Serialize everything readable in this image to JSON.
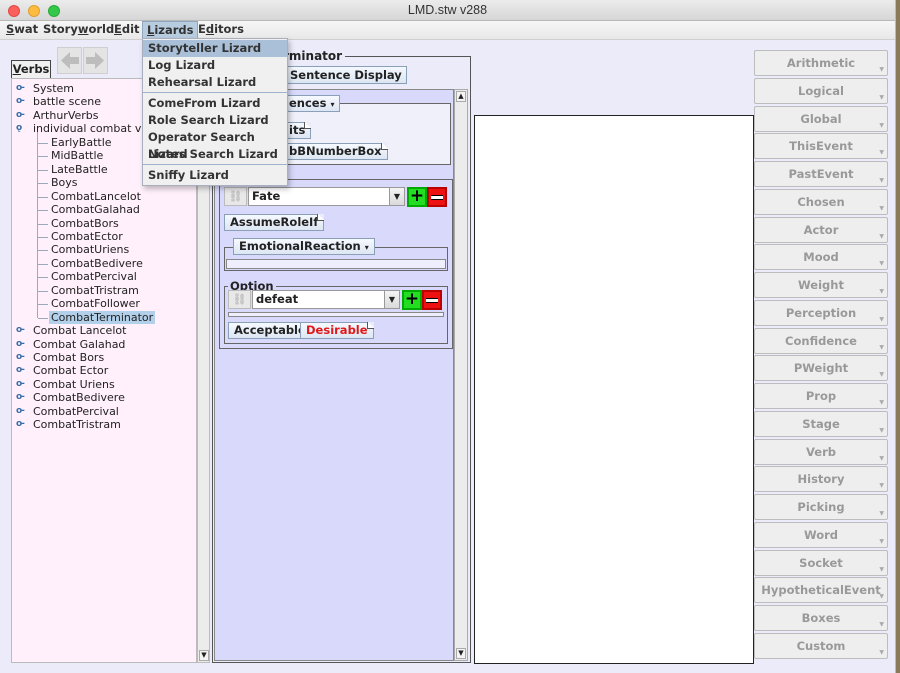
{
  "window": {
    "title": "LMD.stw v288"
  },
  "menubar": {
    "items": [
      {
        "label": "Swat",
        "mnemonic": "S"
      },
      {
        "label": "Storyworld",
        "mnemonic": "w"
      },
      {
        "label": "Edit",
        "mnemonic": "E"
      },
      {
        "label": "Lizards",
        "mnemonic": "L",
        "active": true
      },
      {
        "label": "Editors",
        "mnemonic": "d"
      }
    ]
  },
  "lizards_menu": {
    "group1": [
      "Storyteller Lizard",
      "Log Lizard",
      "Rehearsal Lizard"
    ],
    "group2": [
      "ComeFrom Lizard",
      "Role Search Lizard",
      "Operator Search Lizard",
      "Notes Search Lizard"
    ],
    "group3": [
      "Sniffy Lizard"
    ],
    "highlighted": "Storyteller Lizard"
  },
  "left_panel": {
    "tab_label": "Verbs",
    "back_icon": "arrow-left-icon",
    "forward_icon": "arrow-right-icon",
    "tree": {
      "top_level_before": [
        "System",
        "battle scene",
        "ArthurVerbs"
      ],
      "expanded_folder": "individual combat verbs",
      "expanded_folder_visible": "individual combat ver",
      "children": [
        "EarlyBattle",
        "MidBattle",
        "LateBattle",
        "Boys",
        "CombatLancelot",
        "CombatGalahad",
        "CombatBors",
        "CombatEctor",
        "CombatUriens",
        "CombatBedivere",
        "CombatPercival",
        "CombatTristram",
        "CombatFollower",
        "CombatTerminator"
      ],
      "selected": "CombatTerminator",
      "top_level_after": [
        "Combat Lancelot",
        "Combat Galahad",
        "Combat Bors",
        "Combat Ector",
        "Combat Uriens",
        "CombatBedivere",
        "CombatPercival",
        "CombatTristram"
      ]
    }
  },
  "editor": {
    "title_visible": "rminator",
    "sentence_display_label": "Sentence Display",
    "consequences_label_visible": "ences",
    "chip1_visible": "its",
    "chip2_visible": "bBNumberBox",
    "role_combo_value": "Fate",
    "assume_role_if_label": "AssumeRoleIf",
    "emotional_reaction_label": "EmotionalReaction",
    "option_group_label": "Option",
    "option_combo_value": "defeat",
    "acceptable_label": "Acceptable",
    "desirable_label": "Desirable",
    "desirable_color": "#e01818",
    "plus_symbol": "+",
    "minus_symbol": "−"
  },
  "operators": {
    "items": [
      "Arithmetic",
      "Logical",
      "Global",
      "ThisEvent",
      "PastEvent",
      "Chosen",
      "Actor",
      "Mood",
      "Weight",
      "Perception",
      "Confidence",
      "PWeight",
      "Prop",
      "Stage",
      "Verb",
      "History",
      "Picking",
      "Word",
      "Socket",
      "HypotheticalEvent",
      "Boxes",
      "Custom"
    ]
  },
  "colors": {
    "window_bg": "#ebebfa",
    "tree_bg": "#fff0fb",
    "editor_bg": "#d9d9fc",
    "plus_green": "#22dd22",
    "minus_red": "#ee1111",
    "selection": "#b3d0ea"
  }
}
